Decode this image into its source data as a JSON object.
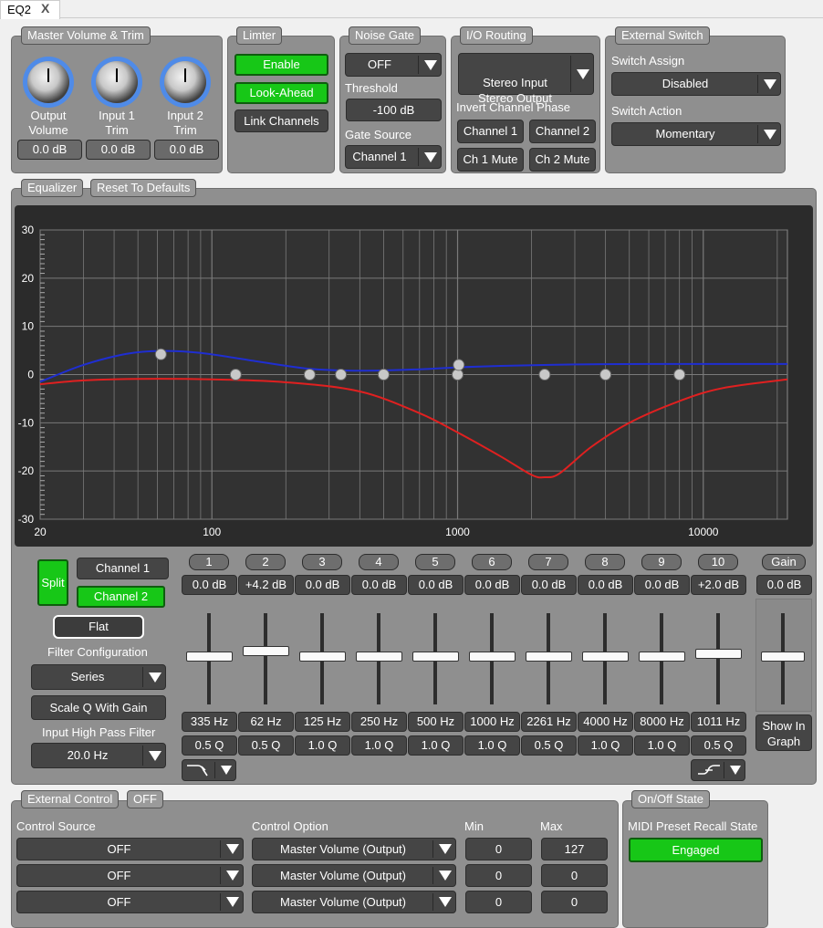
{
  "tab": {
    "label": "EQ2",
    "close": "X"
  },
  "master": {
    "title": "Master Volume & Trim",
    "knobs": [
      {
        "label": "Output\nVolume",
        "value": "0.0 dB"
      },
      {
        "label": "Input 1\nTrim",
        "value": "0.0 dB"
      },
      {
        "label": "Input 2\nTrim",
        "value": "0.0 dB"
      }
    ]
  },
  "limiter": {
    "title": "Limter",
    "enable": "Enable",
    "lookahead": "Look-Ahead",
    "link": "Link Channels"
  },
  "gate": {
    "title": "Noise Gate",
    "state": "OFF",
    "threshold_label": "Threshold",
    "threshold": "-100 dB",
    "source_label": "Gate Source",
    "source": "Channel 1"
  },
  "io": {
    "title": "I/O Routing",
    "routing": "Stereo Input\nStereo Output",
    "invert_label": "Invert Channel Phase",
    "ch1": "Channel 1",
    "ch2": "Channel 2",
    "ch1mute": "Ch 1 Mute",
    "ch2mute": "Ch 2 Mute"
  },
  "extswitch": {
    "title": "External Switch",
    "assign_label": "Switch Assign",
    "assign": "Disabled",
    "action_label": "Switch Action",
    "action": "Momentary"
  },
  "eq": {
    "title": "Equalizer",
    "reset": "Reset To Defaults",
    "split": "Split",
    "channel1": "Channel 1",
    "channel2": "Channel 2",
    "flat": "Flat",
    "filter_config_label": "Filter Configuration",
    "filter_config": "Series",
    "scaleq": "Scale Q With Gain",
    "hpf_label": "Input High Pass Filter",
    "hpf": "20.0 Hz",
    "gain_label": "Gain",
    "gain_value": "0.0 dB",
    "show_graph": "Show In\nGraph",
    "bands": [
      {
        "num": "1",
        "gain": "0.0 dB",
        "freq": "335 Hz",
        "q": "0.5 Q",
        "pos": 0
      },
      {
        "num": "2",
        "gain": "+4.2 dB",
        "freq": "62 Hz",
        "q": "0.5 Q",
        "pos": 4.2
      },
      {
        "num": "3",
        "gain": "0.0 dB",
        "freq": "125 Hz",
        "q": "1.0 Q",
        "pos": 0
      },
      {
        "num": "4",
        "gain": "0.0 dB",
        "freq": "250 Hz",
        "q": "1.0 Q",
        "pos": 0
      },
      {
        "num": "5",
        "gain": "0.0 dB",
        "freq": "500 Hz",
        "q": "1.0 Q",
        "pos": 0
      },
      {
        "num": "6",
        "gain": "0.0 dB",
        "freq": "1000 Hz",
        "q": "1.0 Q",
        "pos": 0
      },
      {
        "num": "7",
        "gain": "0.0 dB",
        "freq": "2261 Hz",
        "q": "0.5 Q",
        "pos": 0
      },
      {
        "num": "8",
        "gain": "0.0 dB",
        "freq": "4000 Hz",
        "q": "1.0 Q",
        "pos": 0
      },
      {
        "num": "9",
        "gain": "0.0 dB",
        "freq": "8000 Hz",
        "q": "1.0 Q",
        "pos": 0
      },
      {
        "num": "10",
        "gain": "+2.0 dB",
        "freq": "1011 Hz",
        "q": "0.5 Q",
        "pos": 2.0
      }
    ]
  },
  "chart_data": {
    "type": "line",
    "xscale": "log",
    "xlim": [
      20,
      22000
    ],
    "ylim": [
      -30,
      30
    ],
    "xticks": [
      "20",
      "100",
      "1000",
      "10000"
    ],
    "yticks": [
      "30",
      "20",
      "10",
      "0",
      "-10",
      "-20",
      "-30"
    ],
    "series": [
      {
        "color": "#1f2ed1",
        "x": [
          20,
          30,
          45,
          62,
          90,
          150,
          250,
          400,
          700,
          1000,
          1500,
          3000,
          6000,
          10000,
          22000
        ],
        "y": [
          -1.5,
          2,
          4.3,
          4.9,
          4.5,
          2.8,
          1.2,
          0.8,
          1.1,
          1.5,
          1.8,
          2.1,
          2.2,
          2.2,
          2.2
        ]
      },
      {
        "color": "#e02020",
        "x": [
          20,
          30,
          50,
          100,
          200,
          400,
          700,
          1000,
          1500,
          2000,
          2261,
          2600,
          3500,
          5000,
          8000,
          12000,
          22000
        ],
        "y": [
          -2,
          -1.2,
          -0.9,
          -1,
          -1.6,
          -3.5,
          -8,
          -12,
          -17,
          -20.8,
          -21.3,
          -20.5,
          -15,
          -10,
          -5.5,
          -2.8,
          -1
        ]
      }
    ],
    "points": [
      {
        "x": 62,
        "y": 4.2
      },
      {
        "x": 125,
        "y": 0
      },
      {
        "x": 250,
        "y": 0
      },
      {
        "x": 335,
        "y": 0
      },
      {
        "x": 500,
        "y": 0
      },
      {
        "x": 1000,
        "y": 0
      },
      {
        "x": 1011,
        "y": 2.0
      },
      {
        "x": 2261,
        "y": 0
      },
      {
        "x": 4000,
        "y": 0
      },
      {
        "x": 8000,
        "y": 0
      }
    ]
  },
  "extctrl": {
    "title": "External Control",
    "state": "OFF",
    "source_label": "Control Source",
    "option_label": "Control Option",
    "min_label": "Min",
    "max_label": "Max",
    "rows": [
      {
        "source": "OFF",
        "option": "Master Volume (Output)",
        "min": "0",
        "max": "127"
      },
      {
        "source": "OFF",
        "option": "Master Volume (Output)",
        "min": "0",
        "max": "0"
      },
      {
        "source": "OFF",
        "option": "Master Volume (Output)",
        "min": "0",
        "max": "0"
      }
    ]
  },
  "onoff": {
    "title": "On/Off State",
    "label": "MIDI Preset Recall State",
    "value": "Engaged"
  }
}
